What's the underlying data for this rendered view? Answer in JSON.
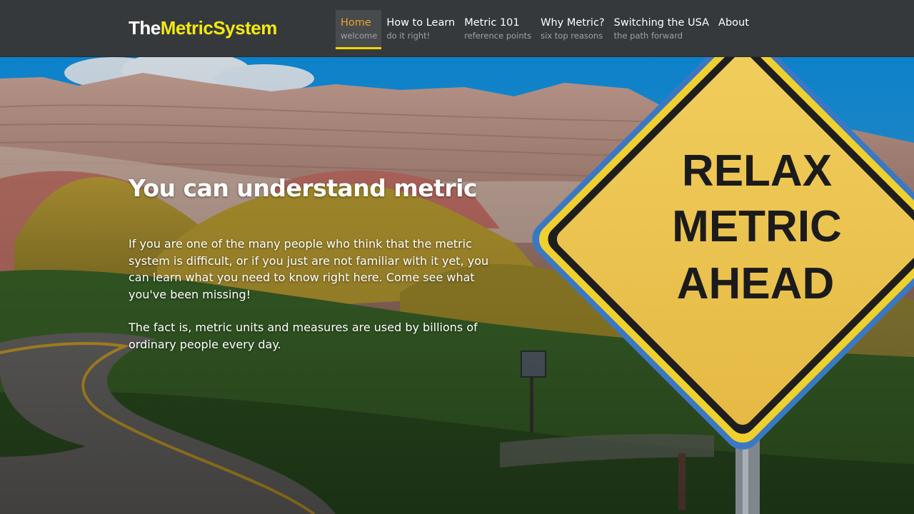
{
  "brand": {
    "part1": "The",
    "part2": "MetricSystem"
  },
  "nav": [
    {
      "label": "Home",
      "sub": "welcome",
      "active": true
    },
    {
      "label": "How to Learn",
      "sub": "do it right!"
    },
    {
      "label": "Metric 101",
      "sub": "reference points"
    },
    {
      "label": "Why Metric?",
      "sub": "six top reasons"
    },
    {
      "label": "Switching the USA",
      "sub": "the path forward"
    },
    {
      "label": "About",
      "sub": ""
    }
  ],
  "hero": {
    "title": "You can understand metric",
    "paragraph1": "If you are one of the many people who think that the metric system is difficult, or if you just are not familiar with it yet, you can learn what you need to know right here. Come see what you've been missing!",
    "paragraph2": "The fact is, metric units and measures are used by billions of ordinary people every day."
  },
  "sign": {
    "line1": "RELAX",
    "line2": "METRIC",
    "line3": "AHEAD"
  },
  "colors": {
    "accent_yellow": "#f5e90f",
    "nav_active": "#f0a030",
    "header_bg": "#35393c"
  }
}
